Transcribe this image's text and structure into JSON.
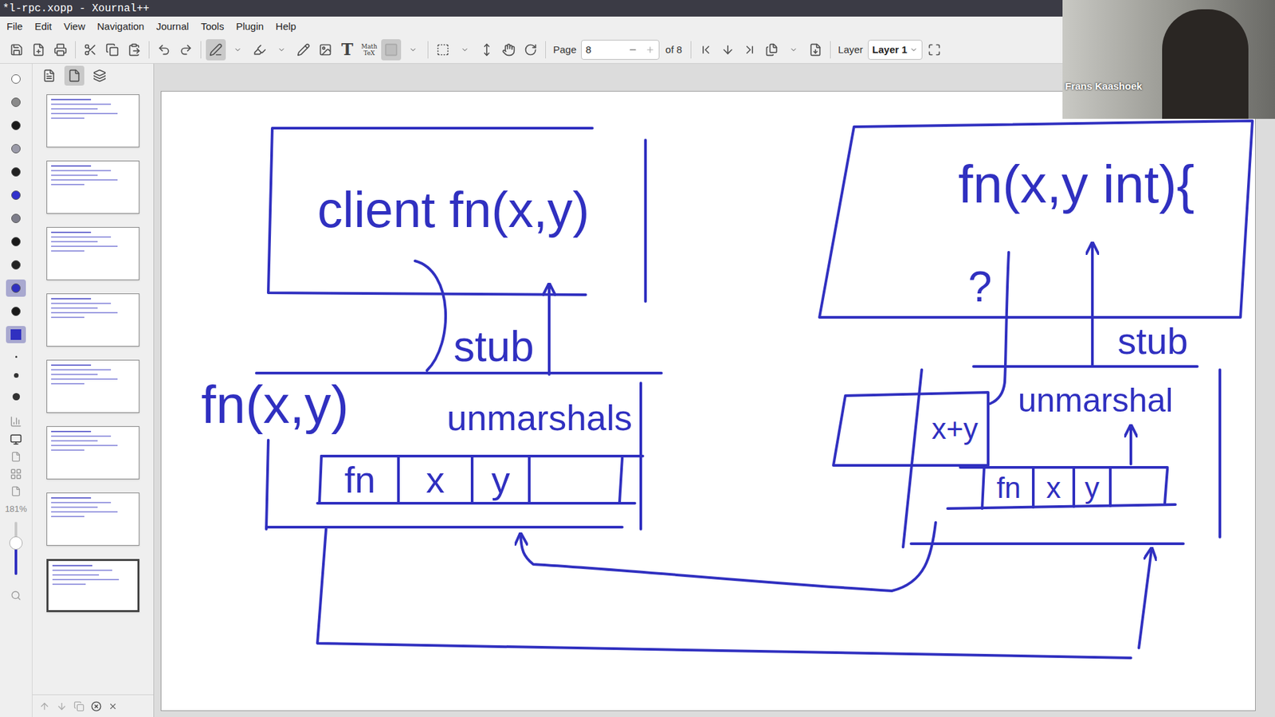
{
  "window": {
    "title": "*l-rpc.xopp - Xournal++"
  },
  "menu": [
    "File",
    "Edit",
    "View",
    "Navigation",
    "Journal",
    "Tools",
    "Plugin",
    "Help"
  ],
  "toolbar": {
    "text_tool": "T",
    "math_tex": [
      "Math",
      "TeX"
    ],
    "page_label": "Page",
    "page_value": "8",
    "page_total": "of 8",
    "layer_label": "Layer",
    "layer_value": "Layer 1"
  },
  "colors": [
    {
      "color": "#ffffff",
      "selected": false
    },
    {
      "color": "#8a8a8a",
      "selected": false
    },
    {
      "color": "#1a1a1a",
      "selected": false
    },
    {
      "color": "#9a9aa8",
      "selected": false
    },
    {
      "color": "#222222",
      "selected": false
    },
    {
      "color": "#3333cc",
      "selected": false
    },
    {
      "color": "#7d7d8a",
      "selected": false
    },
    {
      "color": "#1a1a1a",
      "selected": false
    },
    {
      "color": "#222222",
      "selected": false
    },
    {
      "color": "#3030c0",
      "selected": true
    },
    {
      "color": "#1a1a1a",
      "selected": false
    }
  ],
  "zoom": {
    "reading": "181%",
    "level": 0.6
  },
  "pages": [
    {
      "selected": false
    },
    {
      "selected": false
    },
    {
      "selected": false
    },
    {
      "selected": false
    },
    {
      "selected": false
    },
    {
      "selected": false
    },
    {
      "selected": false
    },
    {
      "selected": true
    }
  ],
  "client": {
    "call": "client fn(x,y)",
    "stub": "stub",
    "stub_fn": "fn(x,y)",
    "unmarshals": "unmarshals",
    "packet": [
      "fn",
      "x",
      "y"
    ]
  },
  "server": {
    "signature": "fn(x,y int){",
    "question": "?",
    "stub": "stub",
    "result": "x+y",
    "unmarshal": "unmarshal",
    "packet": [
      "fn",
      "x",
      "y"
    ]
  },
  "video": {
    "name": "Frans Kaashoek"
  }
}
